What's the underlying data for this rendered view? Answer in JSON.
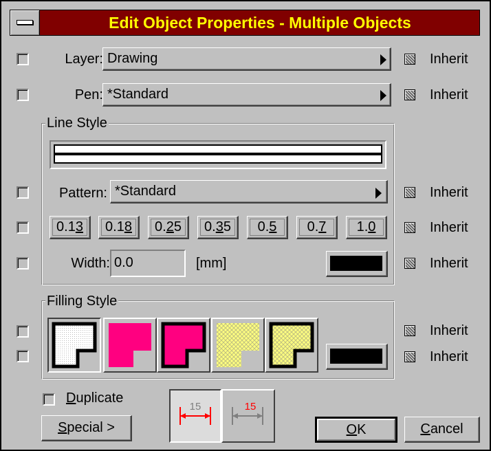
{
  "window": {
    "title": "Edit Object Properties - Multiple Objects"
  },
  "inherit_label": "Inherit",
  "layer": {
    "label": "Layer:",
    "value": "Drawing"
  },
  "pen": {
    "label": "Pen:",
    "value": "*Standard"
  },
  "line_style": {
    "group_title": "Line Style",
    "pattern": {
      "label": "Pattern:",
      "value": "*Standard"
    },
    "widths": [
      {
        "pre": "0.1",
        "ul": "3",
        "post": ""
      },
      {
        "pre": "0.1",
        "ul": "8",
        "post": ""
      },
      {
        "pre": "0.",
        "ul": "2",
        "post": "5"
      },
      {
        "pre": "0.",
        "ul": "3",
        "post": "5"
      },
      {
        "pre": "0.",
        "ul": "5",
        "post": ""
      },
      {
        "pre": "0.",
        "ul": "7",
        "post": ""
      },
      {
        "pre": "1.",
        "ul": "0",
        "post": ""
      }
    ],
    "width": {
      "label": "Width:",
      "value": "0.0",
      "unit": "[mm]"
    },
    "color": "#000000"
  },
  "filling_style": {
    "group_title": "Filling Style",
    "color": "#000000",
    "accent_magenta": "#ff0080",
    "accent_yellow": "#ffff80"
  },
  "duplicate": {
    "pre": "",
    "ul": "D",
    "post": "uplicate"
  },
  "special": {
    "pre": "",
    "ul": "S",
    "post": "pecial >"
  },
  "dimension_icons": {
    "value_left": "15",
    "value_right": "15"
  },
  "ok": {
    "pre": "",
    "ul": "O",
    "post": "K"
  },
  "cancel": {
    "pre": "",
    "ul": "C",
    "post": "ancel"
  }
}
